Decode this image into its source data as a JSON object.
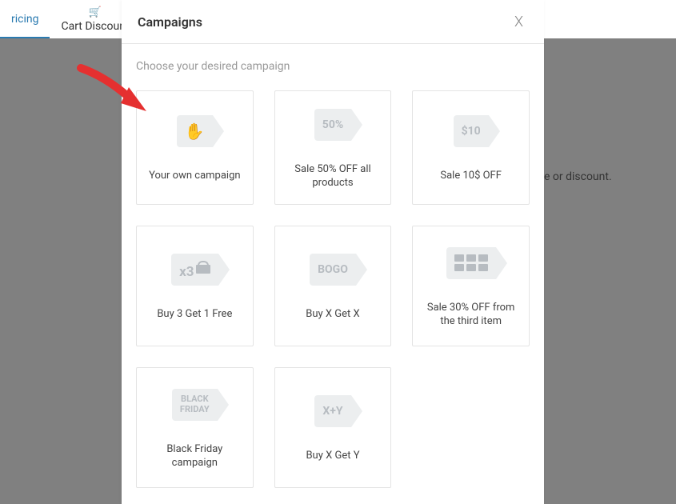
{
  "tabs": {
    "pricing": "ricing",
    "cart_discount": "Cart Discount"
  },
  "background_text": "e or discount.",
  "modal": {
    "title": "Campaigns",
    "close_glyph": "X",
    "subtitle": "Choose your desired campaign",
    "cards": {
      "own": {
        "label": "Your own campaign"
      },
      "fifty": {
        "tag": "50%",
        "label": "Sale 50% OFF all products"
      },
      "ten": {
        "tag": "$10",
        "label": "Sale 10$ OFF"
      },
      "buy3": {
        "tag": "x3",
        "label": "Buy 3 Get 1 Free"
      },
      "bogo": {
        "tag": "BOGO",
        "label": "Buy X Get X"
      },
      "thirty": {
        "label": "Sale 30% OFF from the third item"
      },
      "black": {
        "tag_line1": "BLACK",
        "tag_line2": "FRIDAY",
        "label": "Black Friday campaign"
      },
      "xygetY": {
        "tag": "X+Y",
        "label": "Buy X Get Y"
      }
    }
  }
}
